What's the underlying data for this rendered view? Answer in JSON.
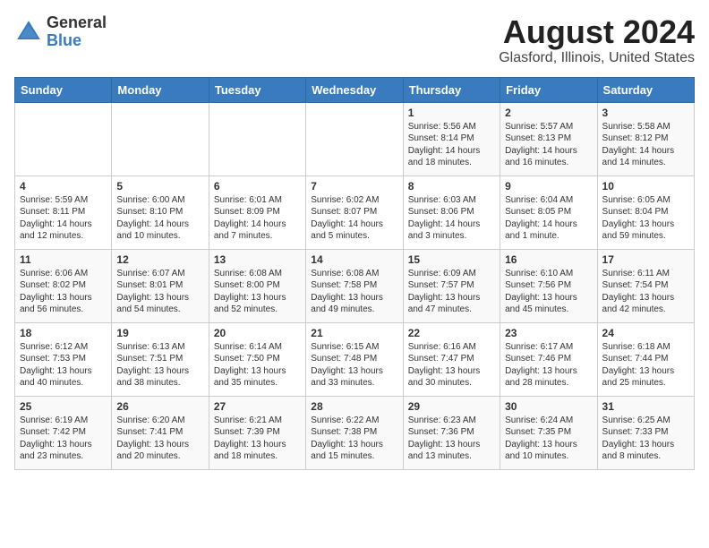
{
  "logo": {
    "general": "General",
    "blue": "Blue"
  },
  "title": "August 2024",
  "location": "Glasford, Illinois, United States",
  "days_of_week": [
    "Sunday",
    "Monday",
    "Tuesday",
    "Wednesday",
    "Thursday",
    "Friday",
    "Saturday"
  ],
  "weeks": [
    [
      {
        "day": "",
        "info": ""
      },
      {
        "day": "",
        "info": ""
      },
      {
        "day": "",
        "info": ""
      },
      {
        "day": "",
        "info": ""
      },
      {
        "day": "1",
        "info": "Sunrise: 5:56 AM\nSunset: 8:14 PM\nDaylight: 14 hours\nand 18 minutes."
      },
      {
        "day": "2",
        "info": "Sunrise: 5:57 AM\nSunset: 8:13 PM\nDaylight: 14 hours\nand 16 minutes."
      },
      {
        "day": "3",
        "info": "Sunrise: 5:58 AM\nSunset: 8:12 PM\nDaylight: 14 hours\nand 14 minutes."
      }
    ],
    [
      {
        "day": "4",
        "info": "Sunrise: 5:59 AM\nSunset: 8:11 PM\nDaylight: 14 hours\nand 12 minutes."
      },
      {
        "day": "5",
        "info": "Sunrise: 6:00 AM\nSunset: 8:10 PM\nDaylight: 14 hours\nand 10 minutes."
      },
      {
        "day": "6",
        "info": "Sunrise: 6:01 AM\nSunset: 8:09 PM\nDaylight: 14 hours\nand 7 minutes."
      },
      {
        "day": "7",
        "info": "Sunrise: 6:02 AM\nSunset: 8:07 PM\nDaylight: 14 hours\nand 5 minutes."
      },
      {
        "day": "8",
        "info": "Sunrise: 6:03 AM\nSunset: 8:06 PM\nDaylight: 14 hours\nand 3 minutes."
      },
      {
        "day": "9",
        "info": "Sunrise: 6:04 AM\nSunset: 8:05 PM\nDaylight: 14 hours\nand 1 minute."
      },
      {
        "day": "10",
        "info": "Sunrise: 6:05 AM\nSunset: 8:04 PM\nDaylight: 13 hours\nand 59 minutes."
      }
    ],
    [
      {
        "day": "11",
        "info": "Sunrise: 6:06 AM\nSunset: 8:02 PM\nDaylight: 13 hours\nand 56 minutes."
      },
      {
        "day": "12",
        "info": "Sunrise: 6:07 AM\nSunset: 8:01 PM\nDaylight: 13 hours\nand 54 minutes."
      },
      {
        "day": "13",
        "info": "Sunrise: 6:08 AM\nSunset: 8:00 PM\nDaylight: 13 hours\nand 52 minutes."
      },
      {
        "day": "14",
        "info": "Sunrise: 6:08 AM\nSunset: 7:58 PM\nDaylight: 13 hours\nand 49 minutes."
      },
      {
        "day": "15",
        "info": "Sunrise: 6:09 AM\nSunset: 7:57 PM\nDaylight: 13 hours\nand 47 minutes."
      },
      {
        "day": "16",
        "info": "Sunrise: 6:10 AM\nSunset: 7:56 PM\nDaylight: 13 hours\nand 45 minutes."
      },
      {
        "day": "17",
        "info": "Sunrise: 6:11 AM\nSunset: 7:54 PM\nDaylight: 13 hours\nand 42 minutes."
      }
    ],
    [
      {
        "day": "18",
        "info": "Sunrise: 6:12 AM\nSunset: 7:53 PM\nDaylight: 13 hours\nand 40 minutes."
      },
      {
        "day": "19",
        "info": "Sunrise: 6:13 AM\nSunset: 7:51 PM\nDaylight: 13 hours\nand 38 minutes."
      },
      {
        "day": "20",
        "info": "Sunrise: 6:14 AM\nSunset: 7:50 PM\nDaylight: 13 hours\nand 35 minutes."
      },
      {
        "day": "21",
        "info": "Sunrise: 6:15 AM\nSunset: 7:48 PM\nDaylight: 13 hours\nand 33 minutes."
      },
      {
        "day": "22",
        "info": "Sunrise: 6:16 AM\nSunset: 7:47 PM\nDaylight: 13 hours\nand 30 minutes."
      },
      {
        "day": "23",
        "info": "Sunrise: 6:17 AM\nSunset: 7:46 PM\nDaylight: 13 hours\nand 28 minutes."
      },
      {
        "day": "24",
        "info": "Sunrise: 6:18 AM\nSunset: 7:44 PM\nDaylight: 13 hours\nand 25 minutes."
      }
    ],
    [
      {
        "day": "25",
        "info": "Sunrise: 6:19 AM\nSunset: 7:42 PM\nDaylight: 13 hours\nand 23 minutes."
      },
      {
        "day": "26",
        "info": "Sunrise: 6:20 AM\nSunset: 7:41 PM\nDaylight: 13 hours\nand 20 minutes."
      },
      {
        "day": "27",
        "info": "Sunrise: 6:21 AM\nSunset: 7:39 PM\nDaylight: 13 hours\nand 18 minutes."
      },
      {
        "day": "28",
        "info": "Sunrise: 6:22 AM\nSunset: 7:38 PM\nDaylight: 13 hours\nand 15 minutes."
      },
      {
        "day": "29",
        "info": "Sunrise: 6:23 AM\nSunset: 7:36 PM\nDaylight: 13 hours\nand 13 minutes."
      },
      {
        "day": "30",
        "info": "Sunrise: 6:24 AM\nSunset: 7:35 PM\nDaylight: 13 hours\nand 10 minutes."
      },
      {
        "day": "31",
        "info": "Sunrise: 6:25 AM\nSunset: 7:33 PM\nDaylight: 13 hours\nand 8 minutes."
      }
    ]
  ]
}
